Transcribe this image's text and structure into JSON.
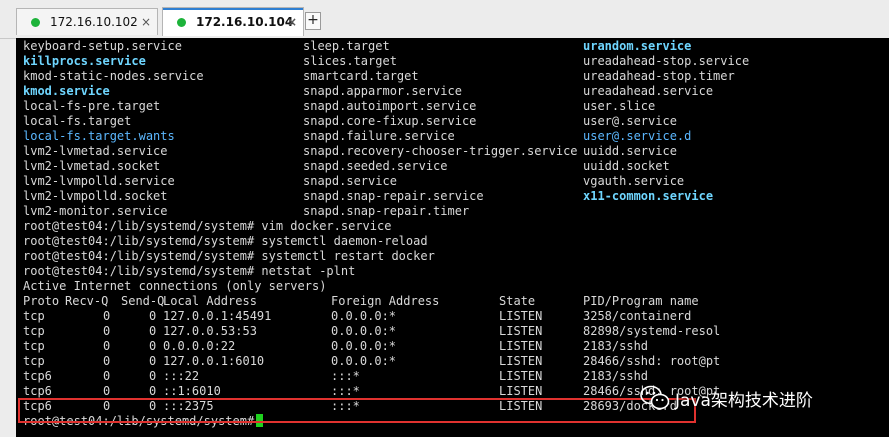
{
  "tabs": [
    {
      "label": "172.16.10.102",
      "active": false
    },
    {
      "label": "172.16.10.104",
      "active": true
    }
  ],
  "tab_close_glyph": "×",
  "add_tab_glyph": "+",
  "colors": {
    "terminal_bg": "#000000",
    "terminal_text": "#d9d9d9",
    "highlight": "#6fd6ff",
    "status_dot": "#1db33a",
    "cursor": "#1fd21f",
    "annotation_box": "#e0322f"
  },
  "service_listing": [
    [
      "keyboard-setup.service",
      "sleep.target",
      "urandom.service"
    ],
    [
      "killprocs.service",
      "slices.target",
      "ureadahead-stop.service"
    ],
    [
      "kmod-static-nodes.service",
      "smartcard.target",
      "ureadahead-stop.timer"
    ],
    [
      "kmod.service",
      "snapd.apparmor.service",
      "ureadahead.service"
    ],
    [
      "local-fs-pre.target",
      "snapd.autoimport.service",
      "user.slice"
    ],
    [
      "local-fs.target",
      "snapd.core-fixup.service",
      "user@.service"
    ],
    [
      "local-fs.target.wants",
      "snapd.failure.service",
      "user@.service.d"
    ],
    [
      "lvm2-lvmetad.service",
      "snapd.recovery-chooser-trigger.service",
      "uuidd.service"
    ],
    [
      "lvm2-lvmetad.socket",
      "snapd.seeded.service",
      "uuidd.socket"
    ],
    [
      "lvm2-lvmpolld.service",
      "snapd.service",
      "vgauth.service"
    ],
    [
      "lvm2-lvmpolld.socket",
      "snapd.snap-repair.service",
      "x11-common.service"
    ],
    [
      "lvm2-monitor.service",
      "snapd.snap-repair.timer",
      ""
    ]
  ],
  "commands": [
    "root@test04:/lib/systemd/system# vim docker.service",
    "root@test04:/lib/systemd/system# systemctl daemon-reload",
    "root@test04:/lib/systemd/system# systemctl restart docker",
    "root@test04:/lib/systemd/system# netstat -plnt"
  ],
  "netstat": {
    "title": "Active Internet connections (only servers)",
    "headers": [
      "Proto",
      "Recv-Q",
      "Send-Q",
      "Local Address",
      "Foreign Address",
      "State",
      "PID/Program name"
    ],
    "rows": [
      [
        "tcp",
        "0",
        "0",
        "127.0.0.1:45491",
        "0.0.0.0:*",
        "LISTEN",
        "3258/containerd"
      ],
      [
        "tcp",
        "0",
        "0",
        "127.0.0.53:53",
        "0.0.0.0:*",
        "LISTEN",
        "82898/systemd-resol"
      ],
      [
        "tcp",
        "0",
        "0",
        "0.0.0.0:22",
        "0.0.0.0:*",
        "LISTEN",
        "2183/sshd"
      ],
      [
        "tcp",
        "0",
        "0",
        "127.0.0.1:6010",
        "0.0.0.0:*",
        "LISTEN",
        "28466/sshd: root@pt"
      ],
      [
        "tcp6",
        "0",
        "0",
        ":::22",
        ":::*",
        "LISTEN",
        "2183/sshd"
      ],
      [
        "tcp6",
        "0",
        "0",
        "::1:6010",
        ":::*",
        "LISTEN",
        "28466/sshd: root@pt"
      ],
      [
        "tcp6",
        "0",
        "0",
        ":::2375",
        ":::*",
        "LISTEN",
        "28693/dockerd"
      ]
    ]
  },
  "final_prompt": "root@test04:/lib/systemd/system#",
  "watermark": "Java架构技术进阶"
}
